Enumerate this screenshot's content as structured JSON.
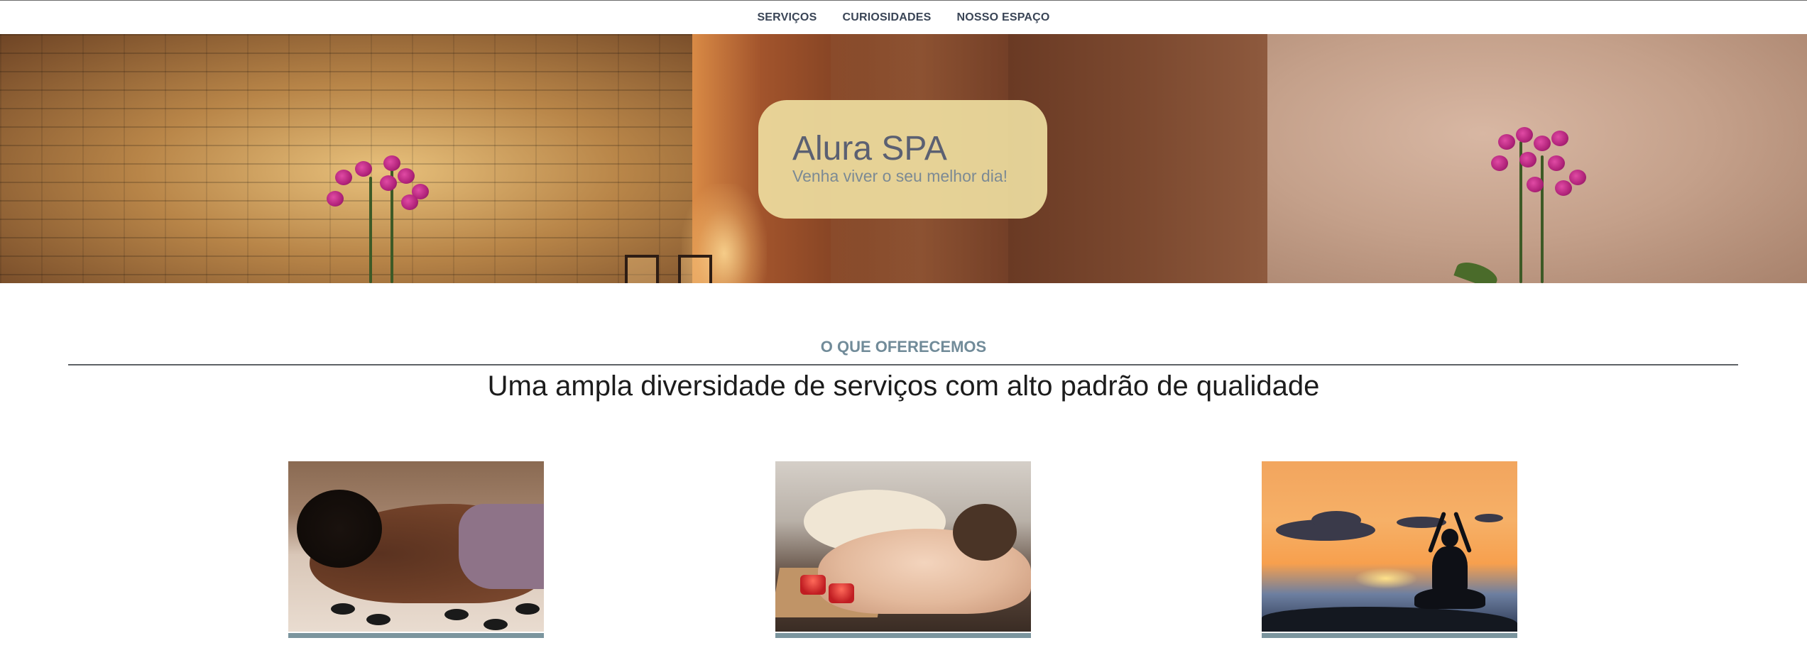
{
  "nav": {
    "items": [
      {
        "label": "SERVIÇOS"
      },
      {
        "label": "CURIOSIDADES"
      },
      {
        "label": "NOSSO ESPAÇO"
      }
    ]
  },
  "hero": {
    "title": "Alura SPA",
    "subtitle": "Venha viver o seu melhor dia!"
  },
  "services_section": {
    "label": "O QUE OFERECEMOS",
    "heading": "Uma ampla diversidade de serviços com alto padrão de qualidade"
  },
  "colors": {
    "nav_text": "#3a4556",
    "hero_card": "#eedda0",
    "hero_title": "#5b6072",
    "hero_subtitle": "#7c8a94",
    "section_label": "#718b99",
    "card_bar": "#7b959e"
  }
}
